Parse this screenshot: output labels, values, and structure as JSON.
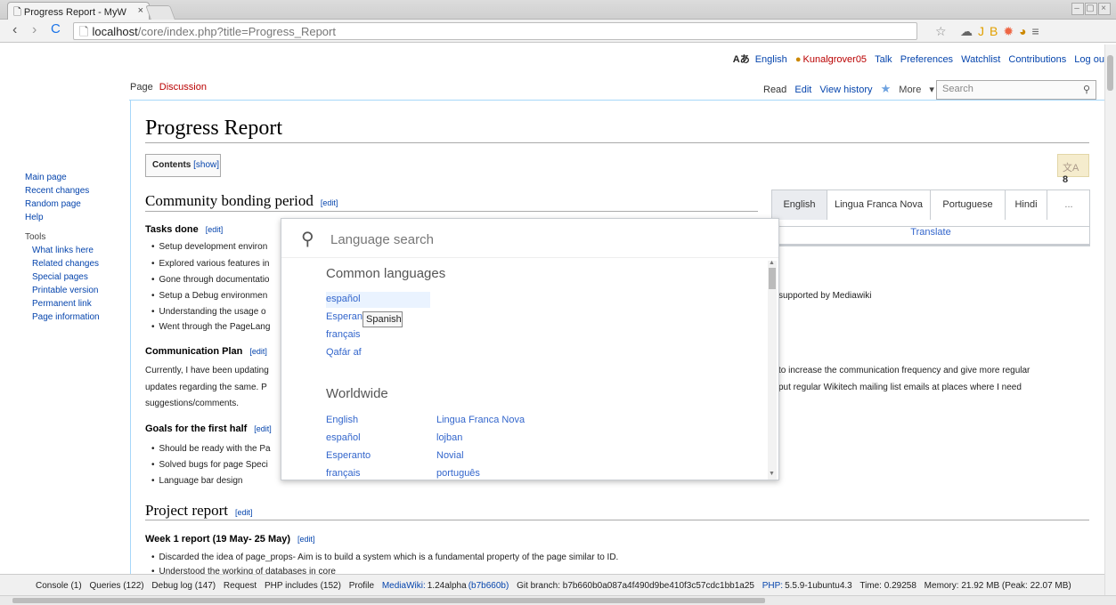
{
  "browser": {
    "tab_title": "Progress Report - MyW",
    "tab_close": "×",
    "url_host": "localhost",
    "url_path": "/core/index.php?title=Progress_Report"
  },
  "personal": [
    "English",
    "Kunalgrover05",
    "Talk",
    "Preferences",
    "Watchlist",
    "Contributions",
    "Log out"
  ],
  "nav": {
    "main": [
      "Main page",
      "Recent changes",
      "Random page",
      "Help"
    ],
    "tools_heading": "Tools",
    "tools": [
      "What links here",
      "Related changes",
      "Special pages",
      "Printable version",
      "Permanent link",
      "Page information"
    ]
  },
  "tabs": {
    "page": "Page",
    "discussion": "Discussion",
    "read": "Read",
    "edit": "Edit",
    "history": "View history",
    "more": "More"
  },
  "search_placeholder": "Search",
  "page": {
    "title": "Progress Report",
    "toc_label": "Contents",
    "toc_show": "[show]",
    "lang_count": "8",
    "edit_link": "[edit]",
    "s1": "Community bonding period",
    "tasks_head": "Tasks done",
    "tasks": [
      "Setup development environ",
      "Explored various features in",
      "Gone through documentatio",
      "Setup a Debug environmen",
      "Understanding the usage o",
      "Went through the PageLang"
    ],
    "tasks_tail": "supported by Mediawiki",
    "comm_head": "Communication Plan",
    "comm_p1a": "Currently, I have been updating",
    "comm_p1b": "to increase the communication frequency and give more regular",
    "comm_p2a": "updates regarding the same. P",
    "comm_p2b": "put regular Wikitech mailing list emails at places where I need",
    "comm_p3": "suggestions/comments.",
    "goals_head": "Goals for the first half",
    "goals": [
      "Should be ready with the Pa",
      "Solved bugs for page Speci",
      "Language bar design"
    ],
    "s2": "Project report",
    "week1_head": "Week 1 report (19 May- 25 May)",
    "week1": [
      "Discarded the idea of page_props- Aim is to build a system which is a fundamental property of the page similar to ID.",
      "Understood the working of databases in core"
    ]
  },
  "translation_bar": {
    "languages": [
      "English",
      "Lingua Franca Nova",
      "Portuguese",
      "Hindi",
      "..."
    ],
    "translate": "Translate"
  },
  "uls": {
    "placeholder": "Language search",
    "common_heading": "Common languages",
    "common": [
      "español",
      "Esperanto",
      "français",
      "Qafár af"
    ],
    "worldwide_heading": "Worldwide",
    "worldwide_col1": [
      "English",
      "español",
      "Esperanto",
      "français"
    ],
    "worldwide_col2": [
      "Lingua Franca Nova",
      "lojban",
      "Novial",
      "português"
    ],
    "tooltip": "Spanish"
  },
  "debug": {
    "items": [
      "Console (1)",
      "Queries (122)",
      "Debug log (147)",
      "Request",
      "PHP includes (152)",
      "Profile"
    ],
    "mediawiki_label": "MediaWiki:",
    "mediawiki_version": "1.24alpha",
    "mediawiki_hash": "(b7b660b)",
    "git": "Git branch: b7b660b0a087a4f490d9be410f3c57cdc1bb1a25",
    "php_label": "PHP:",
    "php": "5.5.9-1ubuntu4.3",
    "time": "Time: 0.29258",
    "memory": "Memory: 21.92 MB (Peak: 22.07 MB)"
  }
}
